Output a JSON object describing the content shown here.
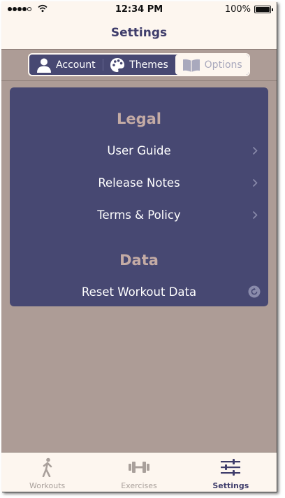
{
  "status_bar": {
    "time": "12:34 PM",
    "battery": "100%",
    "signal_icon": "signal-dots-icon",
    "wifi_icon": "wifi-icon",
    "battery_icon": "battery-icon"
  },
  "nav": {
    "title": "Settings"
  },
  "segments": [
    {
      "label": "Account",
      "icon": "person-icon",
      "selected": false
    },
    {
      "label": "Themes",
      "icon": "palette-icon",
      "selected": false
    },
    {
      "label": "Options",
      "icon": "book-icon",
      "selected": true
    }
  ],
  "legal": {
    "title": "Legal",
    "items": [
      {
        "label": "User Guide",
        "icon": "chevron-right-icon"
      },
      {
        "label": "Release Notes",
        "icon": "chevron-right-icon"
      },
      {
        "label": "Terms & Policy",
        "icon": "chevron-right-icon"
      }
    ]
  },
  "data_section": {
    "title": "Data",
    "items": [
      {
        "label": "Reset Workout Data",
        "icon": "reset-icon"
      }
    ]
  },
  "tabs": [
    {
      "label": "Workouts",
      "icon": "walking-person-icon",
      "active": false
    },
    {
      "label": "Exercises",
      "icon": "dumbbell-icon",
      "active": false
    },
    {
      "label": "Settings",
      "icon": "sliders-icon",
      "active": true
    }
  ],
  "colors": {
    "background": "#ad9c96",
    "bar_background": "#fdf6ef",
    "card": "#474872",
    "section_title": "#c4aba5",
    "nav_title": "#3f3d6b",
    "tab_inactive": "#a9a09b"
  }
}
